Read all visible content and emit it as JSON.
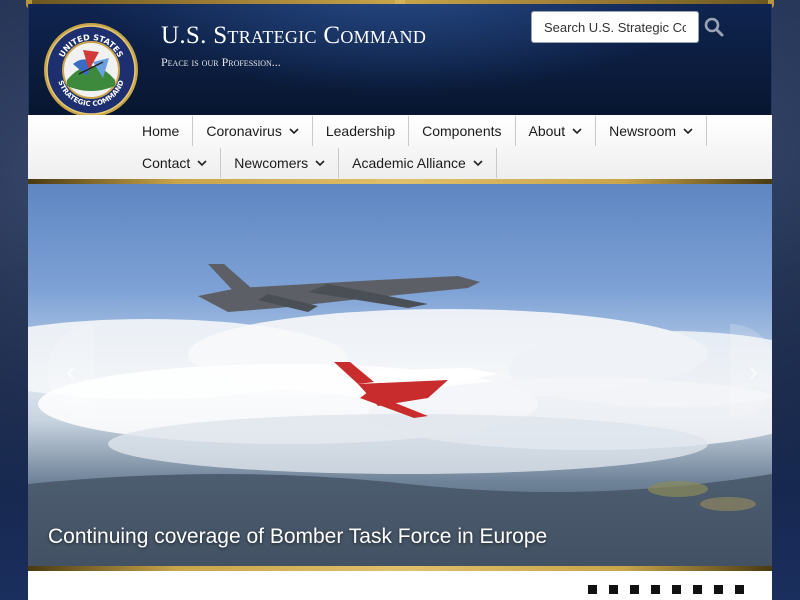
{
  "header": {
    "title": "U.S. Strategic Command",
    "tagline": "Peace is our Profession...",
    "seal": {
      "top_text": "UNITED STATES",
      "bottom_text": "STRATEGIC COMMAND"
    }
  },
  "search": {
    "placeholder": "Search U.S. Strategic Command",
    "icon": "search-icon"
  },
  "nav": {
    "row1": [
      {
        "label": "Home",
        "has_dropdown": false
      },
      {
        "label": "Coronavirus",
        "has_dropdown": true
      },
      {
        "label": "Leadership",
        "has_dropdown": false
      },
      {
        "label": "Components",
        "has_dropdown": false
      },
      {
        "label": "About",
        "has_dropdown": true
      },
      {
        "label": "Newsroom",
        "has_dropdown": true
      }
    ],
    "row2": [
      {
        "label": "Contact",
        "has_dropdown": true
      },
      {
        "label": "Newcomers",
        "has_dropdown": true
      },
      {
        "label": "Academic Alliance",
        "has_dropdown": true
      }
    ]
  },
  "hero": {
    "caption": "Continuing coverage of Bomber Task Force in Europe",
    "prev_icon": "chevron-left-icon",
    "next_icon": "chevron-right-icon",
    "slide_count": 8
  },
  "colors": {
    "header_bg": "#0f2450",
    "gold_accent": "#c9a54a",
    "nav_bg": "#ffffff",
    "text_dark": "#1b1b1b"
  }
}
